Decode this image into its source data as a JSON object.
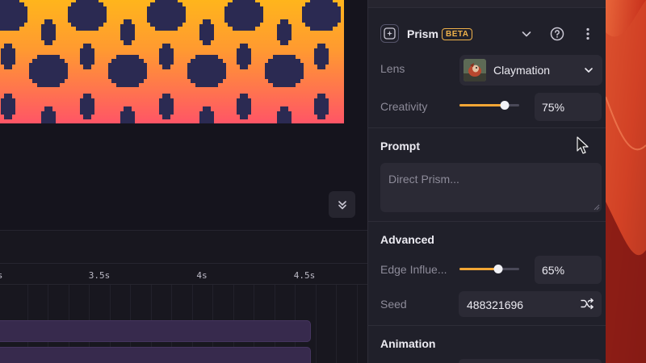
{
  "panel": {
    "title": "Prism",
    "badge": "BETA",
    "lens": {
      "label": "Lens",
      "value": "Claymation"
    },
    "creativity": {
      "label": "Creativity",
      "value": "75%",
      "level": 0.75
    },
    "prompt": {
      "title": "Prompt",
      "placeholder": "Direct Prism..."
    },
    "advanced": {
      "title": "Advanced",
      "edge_influence": {
        "label": "Edge Influe...",
        "value": "65%",
        "level": 0.65
      },
      "seed": {
        "label": "Seed",
        "value": "488321696"
      }
    },
    "animation": {
      "title": "Animation"
    }
  },
  "timeline": {
    "ticks": [
      {
        "label": "s"
      },
      {
        "label": "3.5s"
      },
      {
        "label": "4s"
      },
      {
        "label": "4.5s"
      }
    ]
  },
  "icons": {
    "header": "sparkle-square-icon",
    "collapse": "chevron-double-down-icon",
    "dropdown": "chevron-down-icon",
    "help": "question-circle-icon",
    "more": "vertical-ellipsis-icon",
    "shuffle": "shuffle-icon",
    "cursor": "mouse-cursor-icon"
  },
  "colors": {
    "accent": "#f3a635",
    "beta": "#f0b24a",
    "panel_bg": "#20202a",
    "track": "#372a4d",
    "preview_pattern": "#2b2a52"
  }
}
